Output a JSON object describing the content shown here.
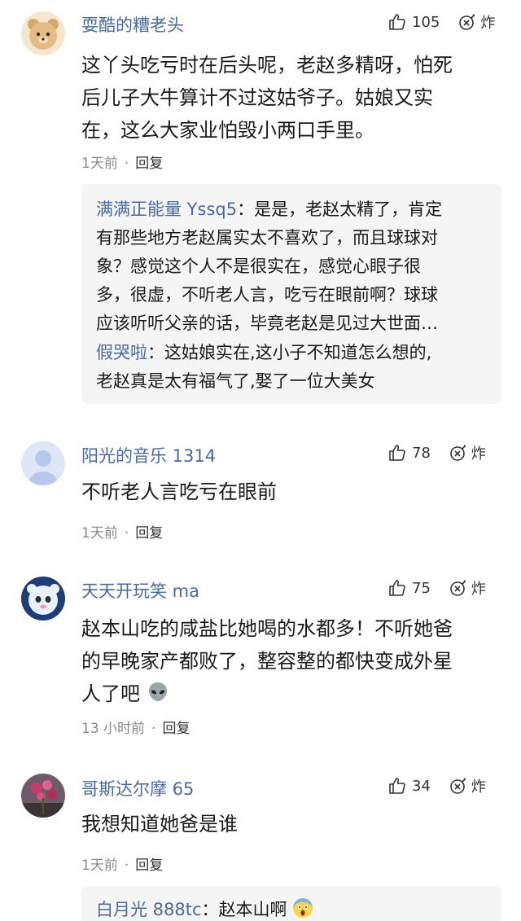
{
  "comments": [
    {
      "username": "耍酷的糟老头",
      "likes": "105",
      "bomb_label": "炸",
      "body": [
        "这丫头吃亏时在后头呢，老赵多精呀，怕死",
        "后儿子大牛算计不过这姑爷子。姑娘又实",
        "在，这么大家业怕毁小两口手里。"
      ],
      "time": "1天前",
      "reply_label": "回复",
      "replies": [
        {
          "name": "满满正能量 Yssq5",
          "sep": "：",
          "lines": [
            "是是，老赵太精了，肯定",
            "有那些地方老赵属实太不喜欢了，而且球球对",
            "象？感觉这个人不是很实在，感觉心眼子很",
            "多，很虚，不听老人言，吃亏在眼前啊？球球",
            "应该听听父亲的话，毕竟老赵是见过大世面…"
          ]
        },
        {
          "name": "假哭啦",
          "sep": "：",
          "lines": [
            "这姑娘实在,这小子不知道怎么想的,",
            "老赵真是太有福气了,娶了一位大美女"
          ]
        }
      ]
    },
    {
      "username": "阳光的音乐 1314",
      "likes": "78",
      "bomb_label": "炸",
      "body": [
        "不听老人言吃亏在眼前"
      ],
      "time": "1天前",
      "reply_label": "回复"
    },
    {
      "username": "天天开玩笑 ma",
      "likes": "75",
      "bomb_label": "炸",
      "body": [
        "赵本山吃的咸盐比她喝的水都多！不听她爸",
        "的早晚家产都败了，整容整的都快变成外星",
        "人了吧"
      ],
      "time": "13 小时前",
      "reply_label": "回复"
    },
    {
      "username": "哥斯达尔摩 65",
      "likes": "34",
      "bomb_label": "炸",
      "body": [
        "我想知道她爸是谁"
      ],
      "time": "1天前",
      "reply_label": "回复",
      "replies": [
        {
          "name": "白月光 888tc",
          "sep": "：",
          "lines": [
            "赵本山啊"
          ]
        }
      ]
    }
  ],
  "colors": {
    "username": "#4a6a9c",
    "text": "#1a1a1a",
    "meta": "#8a8a8a",
    "reply_bg": "#f5f5f5"
  },
  "icons": [
    "thumbs-up-icon",
    "bomb-icon",
    "alien-emoji-icon",
    "scream-emoji-icon"
  ]
}
